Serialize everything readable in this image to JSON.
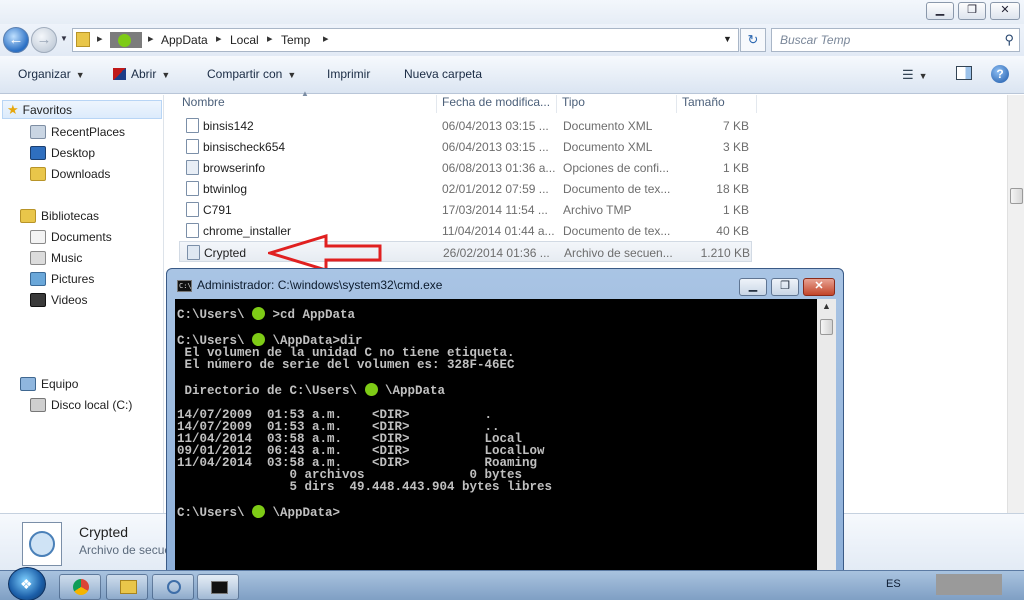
{
  "explorer": {
    "window_controls": {
      "minimize": "▁",
      "maximize": "❐",
      "close": "✕"
    },
    "address": {
      "segments": [
        "AppData",
        "Local",
        "Temp"
      ]
    },
    "search_placeholder": "Buscar Temp",
    "toolbar": {
      "organize": "Organizar",
      "open": "Abrir",
      "share": "Compartir con",
      "print": "Imprimir",
      "new_folder": "Nueva carpeta"
    },
    "nav": {
      "favorites": "Favoritos",
      "recent": "RecentPlaces",
      "desktop": "Desktop",
      "downloads": "Downloads",
      "libraries": "Bibliotecas",
      "documents": "Documents",
      "music": "Music",
      "pictures": "Pictures",
      "videos": "Videos",
      "computer": "Equipo",
      "local_disk": "Disco local (C:)"
    },
    "columns": {
      "name": "Nombre",
      "date": "Fecha de modifica...",
      "type": "Tipo",
      "size": "Tamaño"
    },
    "files": [
      {
        "name": "binsis142",
        "date": "06/04/2013 03:15 ...",
        "type": "Documento XML",
        "size": "7 KB"
      },
      {
        "name": "binsischeck654",
        "date": "06/04/2013 03:15 ...",
        "type": "Documento XML",
        "size": "3 KB"
      },
      {
        "name": "browserinfo",
        "date": "06/08/2013 01:36 a...",
        "type": "Opciones de confi...",
        "size": "1 KB"
      },
      {
        "name": "btwinlog",
        "date": "02/01/2012 07:59 ...",
        "type": "Documento de tex...",
        "size": "18 KB"
      },
      {
        "name": "C791",
        "date": "17/03/2014 11:54 ...",
        "type": "Archivo TMP",
        "size": "1 KB"
      },
      {
        "name": "chrome_installer",
        "date": "11/04/2014 01:44 a...",
        "type": "Documento de tex...",
        "size": "40 KB"
      },
      {
        "name": "Crypted",
        "date": "26/02/2014 01:36 ...",
        "type": "Archivo de secuen...",
        "size": "1.210 KB"
      }
    ],
    "details": {
      "name": "Crypted",
      "type": "Archivo de secue"
    }
  },
  "cmd": {
    "title": "Administrador: C:\\windows\\system32\\cmd.exe",
    "icon_text": "C:\\",
    "controls": {
      "minimize": "▁",
      "maximize": "❐",
      "close": "✕"
    },
    "lines": {
      "prompt1_a": "C:\\Users\\ ",
      "prompt1_b": " >cd AppData",
      "prompt2_a": "C:\\Users\\ ",
      "prompt2_b": " \\AppData>dir",
      "vol1": " El volumen de la unidad C no tiene etiqueta.",
      "vol2": " El número de serie del volumen es: 328F-46EC",
      "dir_a": " Directorio de C:\\Users\\ ",
      "dir_b": " \\AppData",
      "entries": [
        "14/07/2009  01:53 a.m.    <DIR>          .",
        "14/07/2009  01:53 a.m.    <DIR>          ..",
        "11/04/2014  03:58 a.m.    <DIR>          Local",
        "09/01/2012  06:43 a.m.    <DIR>          LocalLow",
        "11/04/2014  03:58 a.m.    <DIR>          Roaming",
        "               0 archivos              0 bytes",
        "               5 dirs  49.448.443.904 bytes libres"
      ],
      "prompt3_a": "C:\\Users\\ ",
      "prompt3_b": " \\AppData>"
    }
  },
  "taskbar": {
    "lang": "ES"
  },
  "colors": {
    "selection_arrow": "#e02020",
    "redaction_green": "#7ecb16",
    "console_bg": "#000000",
    "console_fg": "#c0c0c0"
  }
}
